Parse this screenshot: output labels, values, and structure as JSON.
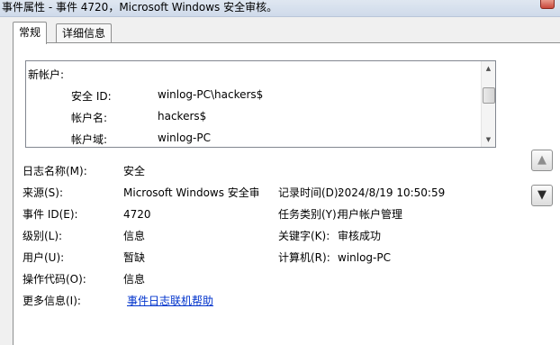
{
  "window": {
    "title": "事件属性 - 事件 4720，Microsoft Windows 安全审核。"
  },
  "tabs": [
    {
      "label": "常规",
      "active": true
    },
    {
      "label": "详细信息",
      "active": false
    }
  ],
  "description": {
    "heading": "新帐户:",
    "rows": [
      {
        "label": "安全 ID:",
        "value": "winlog-PC\\hackers$"
      },
      {
        "label": "帐户名:",
        "value": "hackers$"
      },
      {
        "label": "帐户域:",
        "value": "winlog-PC"
      }
    ]
  },
  "properties": {
    "log_name": {
      "label": "日志名称(M):",
      "value": "安全"
    },
    "source": {
      "label": "来源(S):",
      "value": "Microsoft Windows 安全审"
    },
    "logged": {
      "label": "记录时间(D):",
      "value": "2024/8/19 10:50:59"
    },
    "event_id": {
      "label": "事件 ID(E):",
      "value": "4720"
    },
    "task_category": {
      "label": "任务类别(Y):",
      "value": "用户帐户管理"
    },
    "level": {
      "label": "级别(L):",
      "value": "信息"
    },
    "keywords": {
      "label": "关键字(K):",
      "value": "审核成功"
    },
    "user": {
      "label": "用户(U):",
      "value": "暂缺"
    },
    "computer": {
      "label": "计算机(R):",
      "value": "winlog-PC"
    },
    "opcode": {
      "label": "操作代码(O):",
      "value": "信息"
    },
    "more_info": {
      "label": "更多信息(I):",
      "link": "事件日志联机帮助"
    }
  },
  "icons": {
    "close": "close-icon",
    "up": "arrow-up-icon",
    "down": "arrow-down-icon"
  }
}
